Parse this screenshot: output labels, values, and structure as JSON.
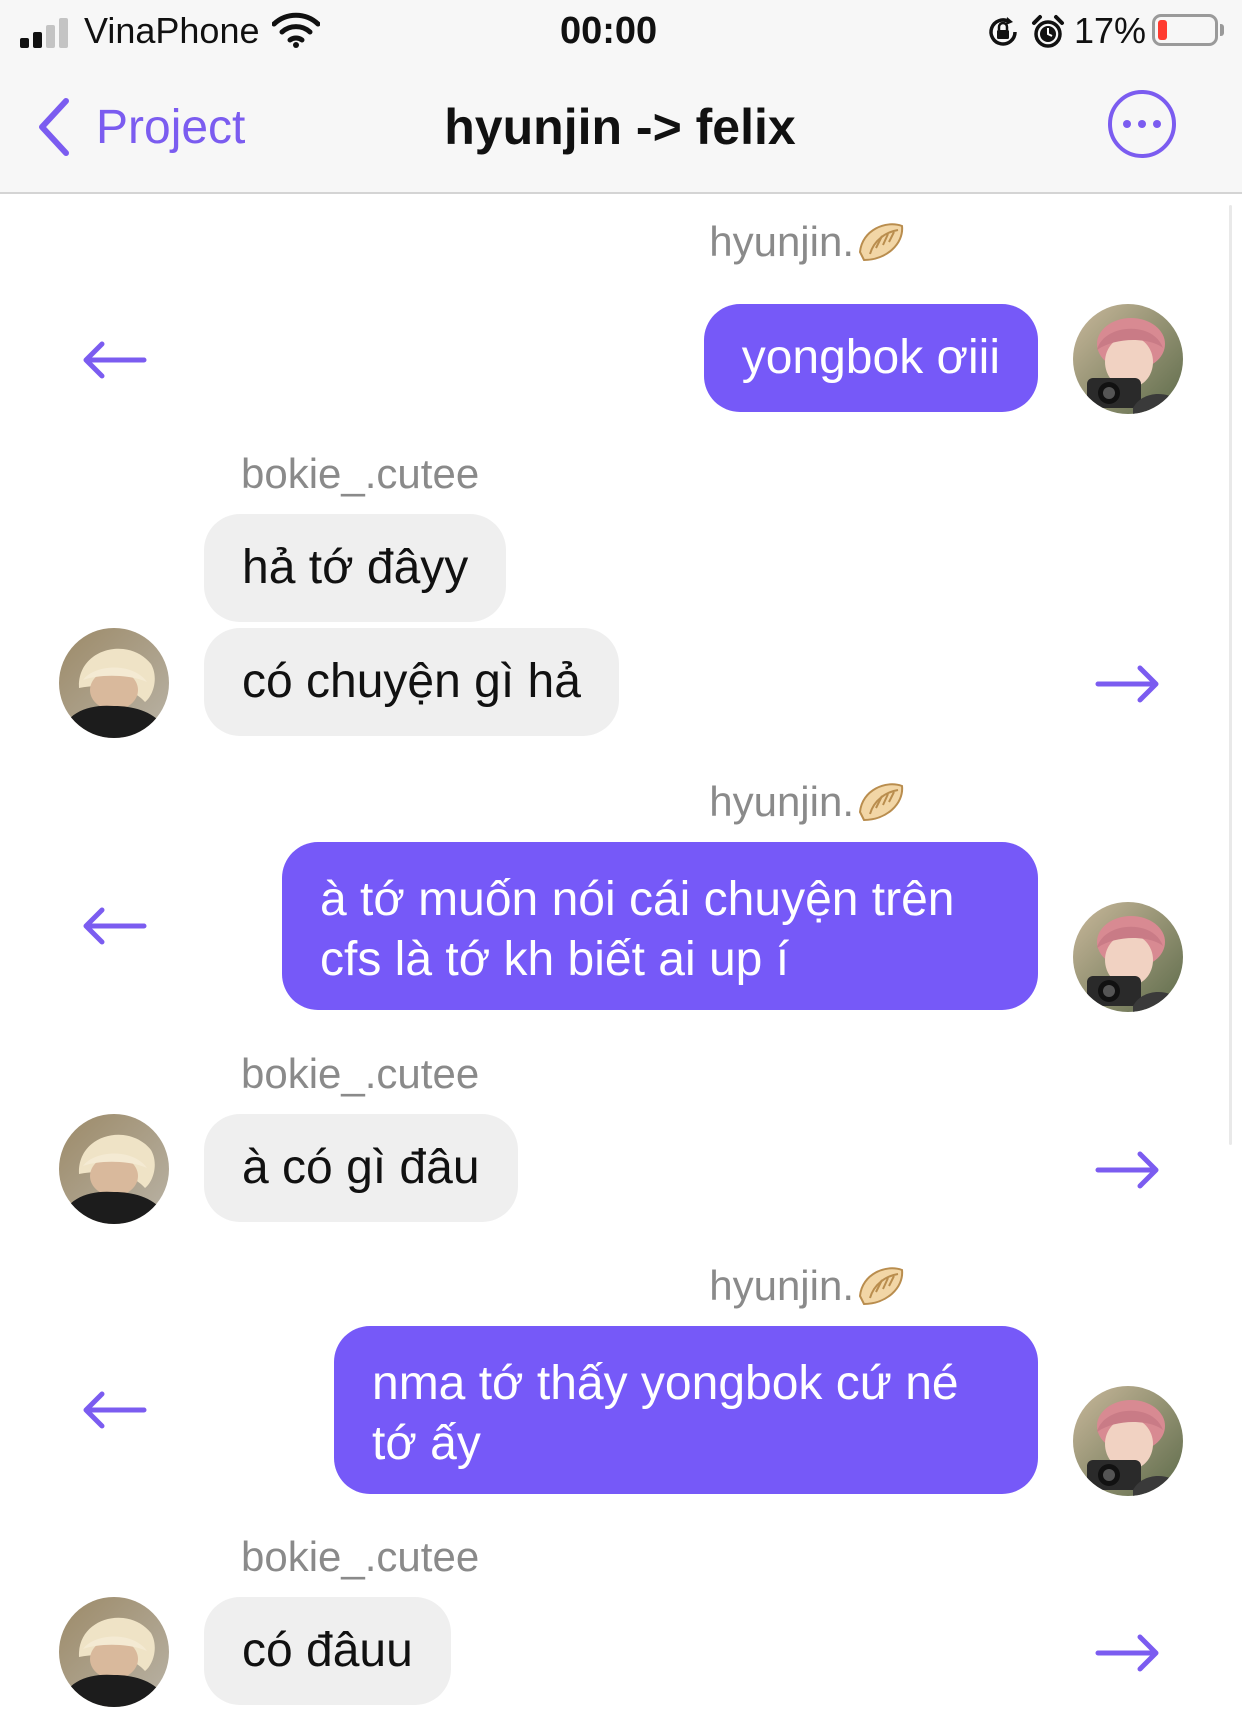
{
  "status_bar": {
    "carrier": "VinaPhone",
    "time": "00:00",
    "battery_percent": "17%",
    "battery_level": 0.17,
    "icons": [
      "signal-icon",
      "wifi-icon",
      "orientation-lock-icon",
      "alarm-icon",
      "battery-icon"
    ]
  },
  "header": {
    "back_label": "Project",
    "title": "hyunjin -> felix",
    "back_icon": "chevron-left-icon",
    "menu_icon": "more-options-icon"
  },
  "messages": [
    {
      "side": "right",
      "sender": "hyunjin.",
      "text": "yongbok ơiii",
      "action_icon": "arrow-left-icon"
    },
    {
      "side": "left",
      "sender": "bokie_.cutee",
      "text": "hả tớ đâyy"
    },
    {
      "side": "left",
      "text": "có chuyện gì hả",
      "action_icon": "arrow-right-icon"
    },
    {
      "side": "right",
      "sender": "hyunjin.",
      "text": "à tớ muốn nói cái chuyện trên cfs là tớ kh biết ai up í",
      "action_icon": "arrow-left-icon"
    },
    {
      "side": "left",
      "sender": "bokie_.cutee",
      "text": "à có gì đâu",
      "action_icon": "arrow-right-icon"
    },
    {
      "side": "right",
      "sender": "hyunjin.",
      "text": "nma tớ thấy yongbok cứ né tớ ấy",
      "action_icon": "arrow-left-icon"
    },
    {
      "side": "left",
      "sender": "bokie_.cutee",
      "text": "có đâuu",
      "action_icon": "arrow-right-icon"
    }
  ],
  "colors": {
    "accent": "#7B5CF0",
    "outgoing_bubble": "#7659F8",
    "incoming_bubble": "#EFEFEF",
    "sender_name": "#8A8A8A",
    "bar_background": "#F7F7F7"
  }
}
